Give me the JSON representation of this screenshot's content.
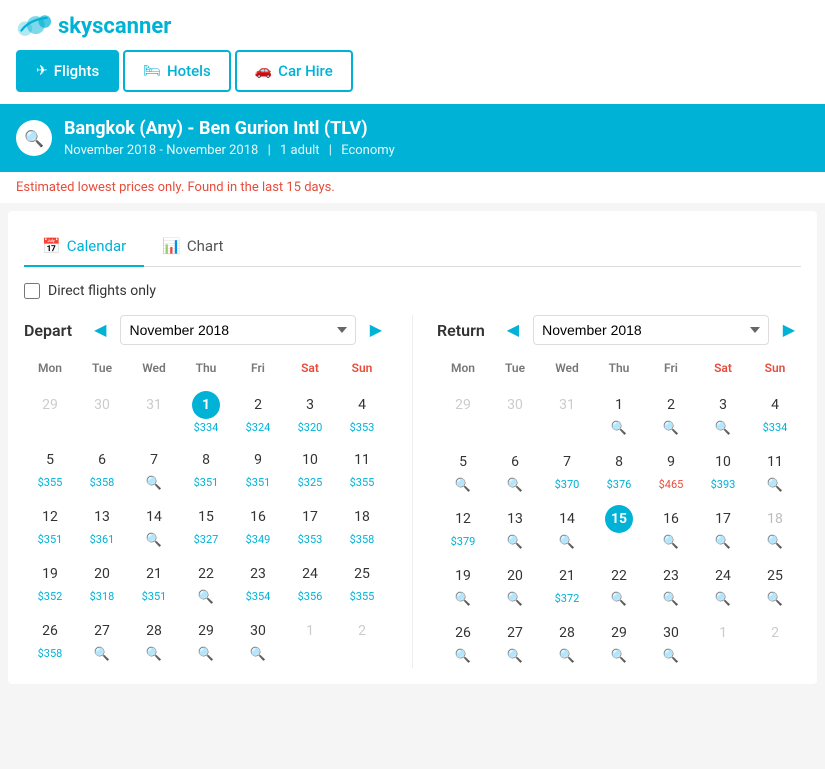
{
  "logo": {
    "text": "skyscanner"
  },
  "tabs": [
    {
      "id": "flights",
      "label": "Flights",
      "icon": "✈",
      "active": true
    },
    {
      "id": "hotels",
      "label": "Hotels",
      "icon": "🛏",
      "active": false
    },
    {
      "id": "carhire",
      "label": "Car Hire",
      "icon": "🚗",
      "active": false
    }
  ],
  "search": {
    "route": "Bangkok (Any) - Ben Gurion Intl (TLV)",
    "dates": "November 2018 - November 2018",
    "travelers": "1",
    "cabin": "Economy"
  },
  "notice": {
    "text_before": "Estimated lowest prices only. Found ",
    "highlight": "in",
    "text_after": " the last 15 days."
  },
  "view_tabs": [
    {
      "id": "calendar",
      "label": "Calendar",
      "icon": "📅",
      "active": true
    },
    {
      "id": "chart",
      "label": "Chart",
      "icon": "📊",
      "active": false
    }
  ],
  "direct_flights_label": "Direct flights only",
  "depart": {
    "label": "Depart",
    "month": "November 2018",
    "days_header": [
      "Mon",
      "Tue",
      "Wed",
      "Thu",
      "Fri",
      "Sat",
      "Sun"
    ],
    "rows": [
      [
        {
          "num": "29",
          "price": "",
          "search": false,
          "other": true
        },
        {
          "num": "30",
          "price": "",
          "search": false,
          "other": true
        },
        {
          "num": "31",
          "price": "",
          "search": false,
          "other": true
        },
        {
          "num": "1",
          "price": "$334",
          "search": false,
          "other": false,
          "selected": true
        },
        {
          "num": "2",
          "price": "$324",
          "search": false,
          "other": false
        },
        {
          "num": "3",
          "price": "$320",
          "search": false,
          "other": false
        },
        {
          "num": "4",
          "price": "$353",
          "search": false,
          "other": false
        }
      ],
      [
        {
          "num": "5",
          "price": "$355",
          "search": false,
          "other": false
        },
        {
          "num": "6",
          "price": "$358",
          "search": false,
          "other": false
        },
        {
          "num": "7",
          "price": "",
          "search": true,
          "other": false
        },
        {
          "num": "8",
          "price": "$351",
          "search": false,
          "other": false
        },
        {
          "num": "9",
          "price": "$351",
          "search": false,
          "other": false
        },
        {
          "num": "10",
          "price": "$325",
          "search": false,
          "other": false
        },
        {
          "num": "11",
          "price": "$355",
          "search": false,
          "other": false
        }
      ],
      [
        {
          "num": "12",
          "price": "$351",
          "search": false,
          "other": false
        },
        {
          "num": "13",
          "price": "$361",
          "search": false,
          "other": false
        },
        {
          "num": "14",
          "price": "",
          "search": true,
          "other": false
        },
        {
          "num": "15",
          "price": "$327",
          "search": false,
          "other": false
        },
        {
          "num": "16",
          "price": "$349",
          "search": false,
          "other": false
        },
        {
          "num": "17",
          "price": "$353",
          "search": false,
          "other": false
        },
        {
          "num": "18",
          "price": "$358",
          "search": false,
          "other": false
        }
      ],
      [
        {
          "num": "19",
          "price": "$352",
          "search": false,
          "other": false
        },
        {
          "num": "20",
          "price": "$318",
          "search": false,
          "other": false
        },
        {
          "num": "21",
          "price": "$351",
          "search": false,
          "other": false
        },
        {
          "num": "22",
          "price": "",
          "search": true,
          "other": false
        },
        {
          "num": "23",
          "price": "$354",
          "search": false,
          "other": false
        },
        {
          "num": "24",
          "price": "$356",
          "search": false,
          "other": false
        },
        {
          "num": "25",
          "price": "$355",
          "search": false,
          "other": false
        }
      ],
      [
        {
          "num": "26",
          "price": "$358",
          "search": false,
          "other": false
        },
        {
          "num": "27",
          "price": "",
          "search": true,
          "other": false
        },
        {
          "num": "28",
          "price": "",
          "search": true,
          "other": false
        },
        {
          "num": "29",
          "price": "",
          "search": true,
          "other": false
        },
        {
          "num": "30",
          "price": "",
          "search": true,
          "other": false
        },
        {
          "num": "1",
          "price": "",
          "search": false,
          "other": true
        },
        {
          "num": "2",
          "price": "",
          "search": false,
          "other": true
        }
      ]
    ]
  },
  "return": {
    "label": "Return",
    "month": "November 2018",
    "days_header": [
      "Mon",
      "Tue",
      "Wed",
      "Thu",
      "Fri",
      "Sat",
      "Sun"
    ],
    "rows": [
      [
        {
          "num": "29",
          "price": "",
          "search": false,
          "other": true
        },
        {
          "num": "30",
          "price": "",
          "search": false,
          "other": true
        },
        {
          "num": "31",
          "price": "",
          "search": false,
          "other": true
        },
        {
          "num": "1",
          "price": "",
          "search": true,
          "other": false
        },
        {
          "num": "2",
          "price": "",
          "search": true,
          "other": false
        },
        {
          "num": "3",
          "price": "",
          "search": true,
          "other": false
        },
        {
          "num": "4",
          "price": "$334",
          "search": false,
          "other": false
        }
      ],
      [
        {
          "num": "5",
          "price": "",
          "search": true,
          "other": false
        },
        {
          "num": "6",
          "price": "",
          "search": true,
          "other": false
        },
        {
          "num": "7",
          "price": "$370",
          "search": false,
          "other": false
        },
        {
          "num": "8",
          "price": "$376",
          "search": false,
          "other": false
        },
        {
          "num": "9",
          "price": "$465",
          "search": false,
          "other": false,
          "red": true
        },
        {
          "num": "10",
          "price": "$393",
          "search": false,
          "other": false
        },
        {
          "num": "11",
          "price": "",
          "search": true,
          "other": false
        }
      ],
      [
        {
          "num": "12",
          "price": "$379",
          "search": false,
          "other": false
        },
        {
          "num": "13",
          "price": "",
          "search": true,
          "other": false
        },
        {
          "num": "14",
          "price": "",
          "search": true,
          "other": false
        },
        {
          "num": "15",
          "price": "",
          "search": false,
          "other": false,
          "selected": true
        },
        {
          "num": "16",
          "price": "",
          "search": true,
          "other": false
        },
        {
          "num": "17",
          "price": "",
          "search": true,
          "other": false
        },
        {
          "num": "18",
          "price": "",
          "search": false,
          "other": false,
          "dimmed": true
        }
      ],
      [
        {
          "num": "19",
          "price": "",
          "search": true,
          "other": false
        },
        {
          "num": "20",
          "price": "",
          "search": true,
          "other": false
        },
        {
          "num": "21",
          "price": "$372",
          "search": false,
          "other": false
        },
        {
          "num": "22",
          "price": "",
          "search": true,
          "other": false
        },
        {
          "num": "23",
          "price": "",
          "search": true,
          "other": false
        },
        {
          "num": "24",
          "price": "",
          "search": true,
          "other": false
        },
        {
          "num": "25",
          "price": "",
          "search": true,
          "other": false
        }
      ],
      [
        {
          "num": "26",
          "price": "",
          "search": true,
          "other": false
        },
        {
          "num": "27",
          "price": "",
          "search": true,
          "other": false
        },
        {
          "num": "28",
          "price": "",
          "search": true,
          "other": false
        },
        {
          "num": "29",
          "price": "",
          "search": true,
          "other": false
        },
        {
          "num": "30",
          "price": "",
          "search": true,
          "other": false
        },
        {
          "num": "1",
          "price": "",
          "search": false,
          "other": true
        },
        {
          "num": "2",
          "price": "",
          "search": false,
          "other": true
        }
      ]
    ]
  }
}
